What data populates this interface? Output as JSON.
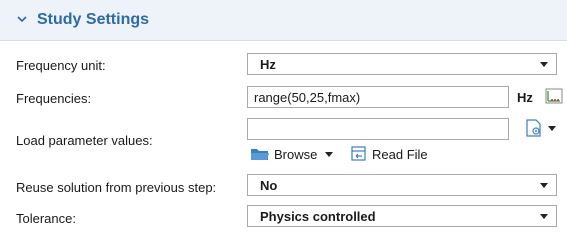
{
  "section": {
    "title": "Study Settings",
    "icon": "chevron-down-icon",
    "accent": "#2e6aa6",
    "header_bg": "#eef3f9"
  },
  "rows": {
    "frequency_unit": {
      "label": "Frequency unit:",
      "value": "Hz"
    },
    "frequencies": {
      "label": "Frequencies:",
      "value": "range(50,25,fmax)",
      "unit": "Hz",
      "range_icon": "range-plot-icon"
    },
    "load_parameter_values": {
      "label": "Load parameter values:",
      "value": "",
      "browse_label": "Browse",
      "read_file_label": "Read File",
      "file_icon": "file-location-icon",
      "browse_icon": "folder-icon",
      "read_file_icon": "read-file-icon"
    },
    "reuse_solution": {
      "label": "Reuse solution from previous step:",
      "value": "No"
    },
    "tolerance": {
      "label": "Tolerance:",
      "value": "Physics controlled"
    }
  }
}
